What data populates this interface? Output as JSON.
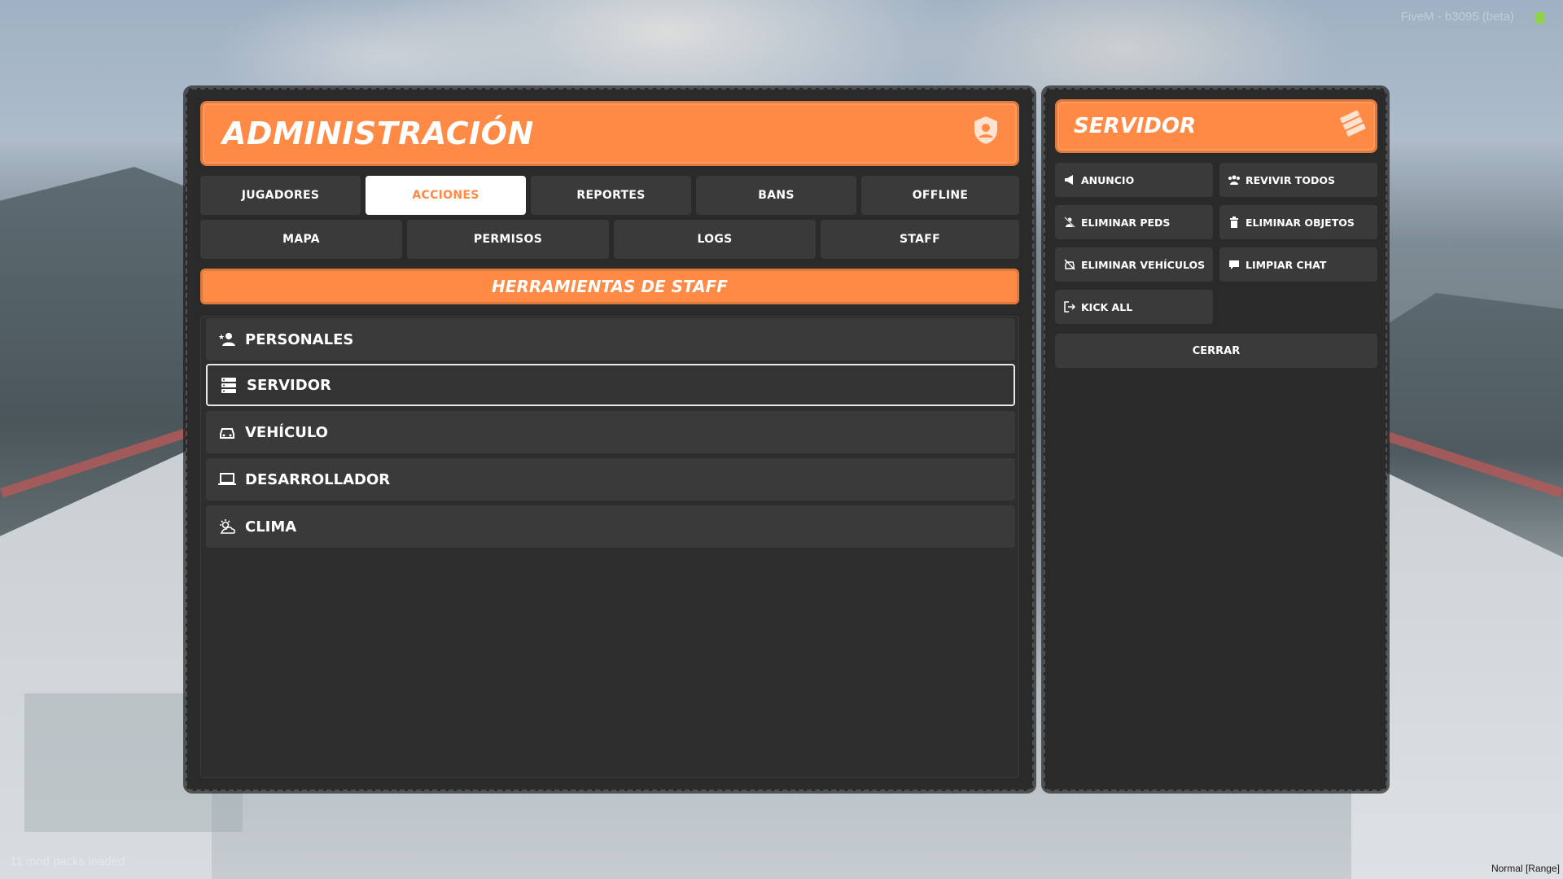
{
  "overlay": {
    "top_right_text": "FiveM - b3095 (beta)",
    "bottom_left_text": "11 mod packs loaded",
    "bottom_right_text": "Normal [Range]"
  },
  "colors": {
    "accent": "#ff8a45",
    "panel_bg": "#2a2a2a",
    "button_bg": "#3a3a3a",
    "text": "#ffffff"
  },
  "main": {
    "title": "ADMINISTRACIÓN",
    "title_icon": "shield-user-icon",
    "tabs_row1": [
      {
        "label": "JUGADORES",
        "active": false
      },
      {
        "label": "ACCIONES",
        "active": true
      },
      {
        "label": "REPORTES",
        "active": false
      },
      {
        "label": "BANS",
        "active": false
      },
      {
        "label": "OFFLINE",
        "active": false
      }
    ],
    "tabs_row2": [
      {
        "label": "MAPA"
      },
      {
        "label": "PERMISOS"
      },
      {
        "label": "LOGS"
      },
      {
        "label": "STAFF"
      }
    ],
    "section_title": "HERRAMIENTAS DE STAFF",
    "items": [
      {
        "label": "PERSONALES",
        "icon": "user-star-icon",
        "selected": false
      },
      {
        "label": "SERVIDOR",
        "icon": "server-icon",
        "selected": true
      },
      {
        "label": "VEHÍCULO",
        "icon": "car-icon",
        "selected": false
      },
      {
        "label": "DESARROLLADOR",
        "icon": "laptop-icon",
        "selected": false
      },
      {
        "label": "CLIMA",
        "icon": "weather-icon",
        "selected": false
      }
    ]
  },
  "side": {
    "title": "SERVIDOR",
    "title_icon": "server-icon",
    "actions": [
      {
        "label": "ANUNCIO",
        "icon": "megaphone-icon"
      },
      {
        "label": "REVIVIR TODOS",
        "icon": "users-icon"
      },
      {
        "label": "ELIMINAR PEDS",
        "icon": "user-remove-icon"
      },
      {
        "label": "ELIMINAR OBJETOS",
        "icon": "trash-icon"
      },
      {
        "label": "ELIMINAR VEHÍCULOS",
        "icon": "car-off-icon"
      },
      {
        "label": "LIMPIAR CHAT",
        "icon": "chat-icon"
      },
      {
        "label": "KICK ALL",
        "icon": "logout-icon"
      }
    ],
    "close_label": "CERRAR"
  }
}
